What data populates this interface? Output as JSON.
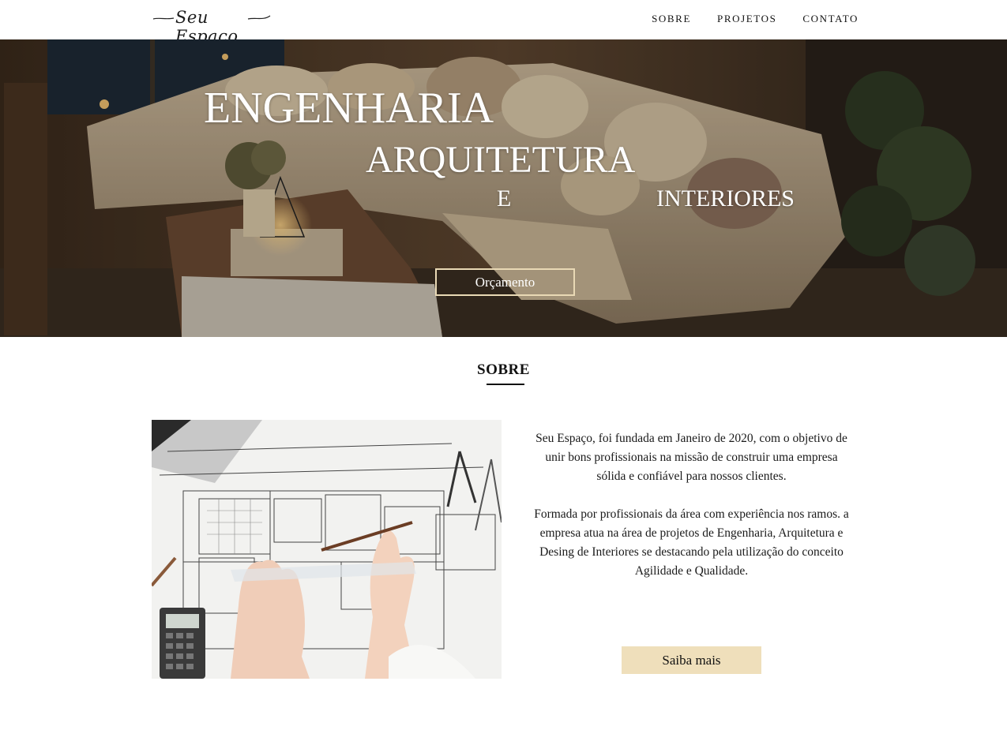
{
  "header": {
    "logo_text": "Seu Espaço",
    "nav": [
      {
        "label": "SOBRE"
      },
      {
        "label": "PROJETOS"
      },
      {
        "label": "CONTATO"
      }
    ]
  },
  "hero": {
    "line1": "ENGENHARIA",
    "line2": "ARQUITETURA",
    "line3a": "E",
    "line3b": "INTERIORES",
    "cta_label": "Orçamento",
    "image_icon": "living-room-photo"
  },
  "about": {
    "title": "SOBRE",
    "image_icon": "blueprint-drawing-photo",
    "paragraph1": "Seu Espaço, foi fundada em Janeiro de 2020, com o objetivo de unir bons profissionais na missão de construir uma empresa sólida e confiável para nossos clientes.",
    "paragraph2": "Formada por profissionais da área com experiência nos ramos. a empresa atua na área de projetos de Engenharia, Arquitetura e Desing de Interiores se destacando pela utilização do conceito Agilidade e Qualidade.",
    "button_label": "Saiba mais"
  },
  "colors": {
    "accent": "#efdfbb",
    "cta_border": "#e9d9b5",
    "text": "#111111"
  }
}
